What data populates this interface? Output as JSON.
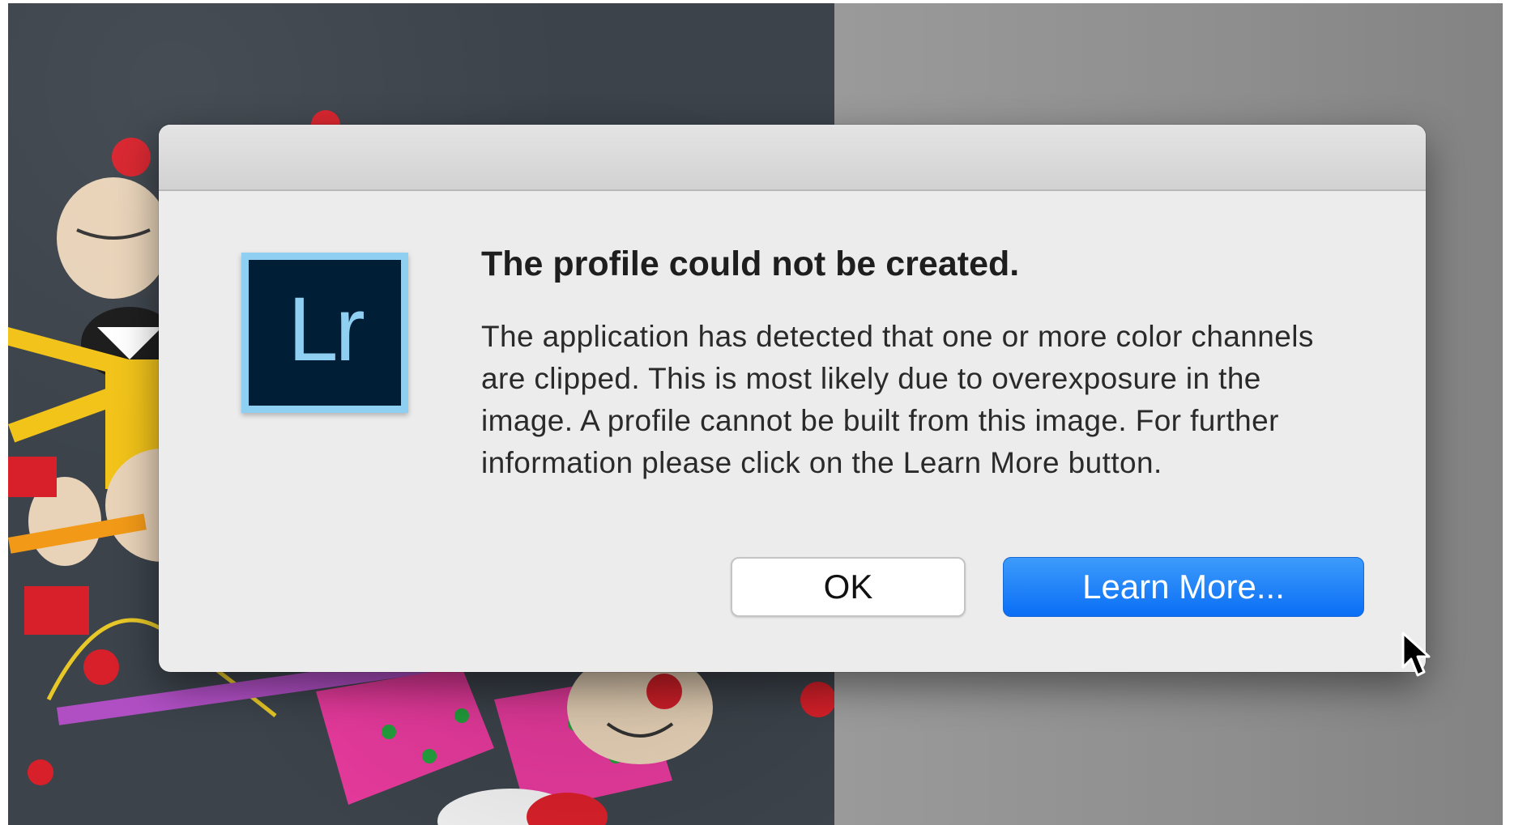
{
  "dialog": {
    "app_icon_text": "Lr",
    "title": "The profile could not be created.",
    "message": "The application has detected that one or more color channels are clipped.  This is most likely due to overexposure in the image.  A profile cannot be built from this image. For further information please click on the Learn More button.",
    "buttons": {
      "ok": "OK",
      "learn_more": "Learn More..."
    }
  },
  "colors": {
    "dialog_bg": "#ececec",
    "primary_button": "#0a6ef5",
    "app_icon_bg": "#001e36",
    "app_icon_accent": "#8fd0f2"
  },
  "icons": {
    "app_icon": "lightroom-app-icon",
    "cursor": "mouse-pointer-icon"
  }
}
